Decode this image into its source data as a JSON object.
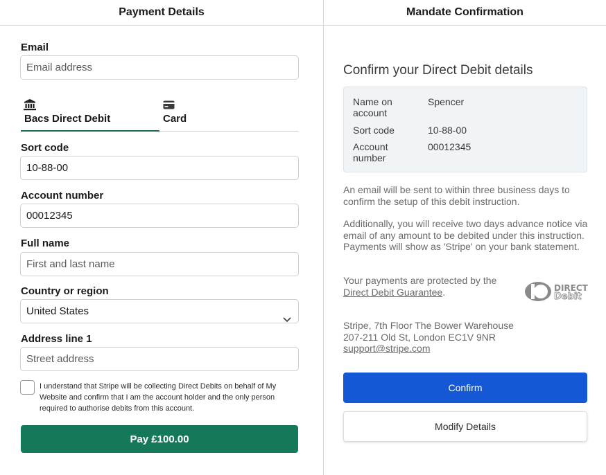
{
  "left_panel": {
    "title": "Payment Details",
    "email": {
      "label": "Email",
      "placeholder": "Email address"
    },
    "tabs": [
      {
        "label": "Bacs Direct Debit",
        "icon": "bank-icon",
        "active": true
      },
      {
        "label": "Card",
        "icon": "card-icon",
        "active": false
      }
    ],
    "sort_code": {
      "label": "Sort code",
      "value": "10-88-00"
    },
    "account_number": {
      "label": "Account number",
      "value": "00012345"
    },
    "full_name": {
      "label": "Full name",
      "placeholder": "First and last name"
    },
    "country": {
      "label": "Country or region",
      "value": "United States"
    },
    "address": {
      "label": "Address line 1",
      "placeholder": "Street address"
    },
    "consent_text": "I understand that Stripe will be collecting Direct Debits on behalf of My Website and confirm that I am the account holder and the only person required to authorise debits from this account.",
    "pay_button": "Pay £100.00"
  },
  "right_panel": {
    "title": "Mandate Confirmation",
    "heading": "Confirm your Direct Debit details",
    "details": [
      {
        "label": "Name on account",
        "value": "Spencer"
      },
      {
        "label": "Sort code",
        "value": "10-88-00"
      },
      {
        "label": "Account number",
        "value": "00012345"
      }
    ],
    "para1": "An email will be sent to within three business days to confirm the setup of this debit instruction.",
    "para2": "Additionally, you will receive two days advance notice via email of any amount to be debited under this instruction. Payments will show as 'Stripe' on your bank statement.",
    "protected_prefix": "Your payments are protected by the",
    "protected_link": "Direct Debit Guarantee",
    "protected_suffix": ".",
    "logo_text_top": "DIRECT",
    "logo_text_bottom": "Debit",
    "address_line1": "Stripe, 7th Floor The Bower Warehouse",
    "address_line2": "207-211 Old St, London EC1V 9NR",
    "support_email": "support@stripe.com",
    "confirm_button": "Confirm",
    "modify_button": "Modify Details"
  },
  "colors": {
    "pay_button": "#16785a",
    "confirm_button": "#1458d6",
    "active_tab_underline": "#1a6b4e"
  }
}
